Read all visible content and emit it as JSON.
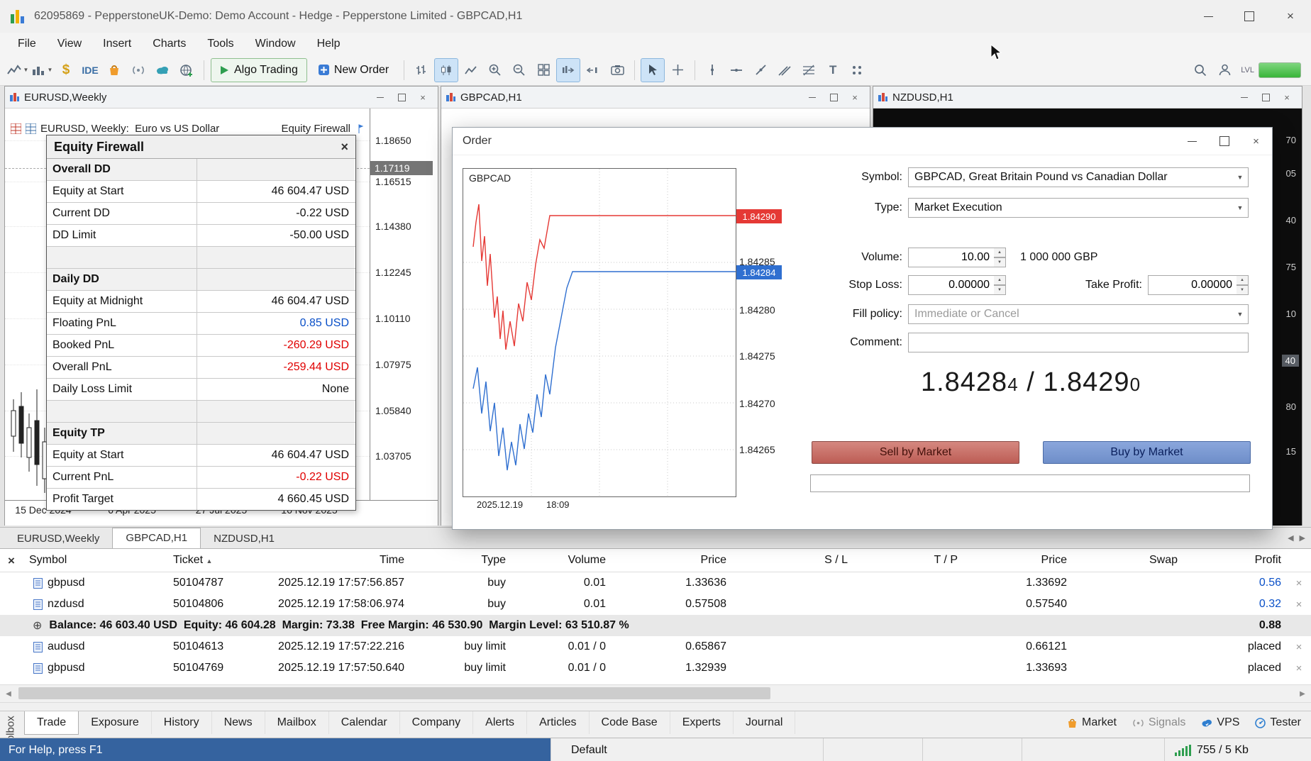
{
  "icons": {
    "close": "×",
    "sort_asc": "▲",
    "caret": "▼",
    "expand": "⊕",
    "arrow_left": "◀",
    "arrow_right": "▶",
    "spin_up": "▲",
    "spin_down": "▼"
  },
  "titlebar": {
    "title": "62095869 - PepperstoneUK-Demo: Demo Account - Hedge - Pepperstone Limited - GBPCAD,H1"
  },
  "menubar": {
    "items": [
      "File",
      "View",
      "Insert",
      "Charts",
      "Tools",
      "Window",
      "Help"
    ]
  },
  "toolbar": {
    "dollar": "$",
    "ide": "IDE",
    "algo_trading": "Algo Trading",
    "new_order": "New Order",
    "text_tool": "T",
    "lvl": "LVL"
  },
  "windows": {
    "eurusd": {
      "title": "EURUSD,Weekly",
      "legend": "EURUSD, Weekly:  Euro vs US Dollar",
      "legend_right": "Equity Firewall",
      "price_labels": [
        "1.18650",
        "1.17119",
        "1.16515",
        "1.14380",
        "1.12245",
        "1.10110",
        "1.07975",
        "1.05840",
        "1.03705"
      ],
      "date_labels": [
        "15 Dec 2024",
        "6 Apr 2025",
        "27 Jul 2025",
        "16 Nov 2025"
      ]
    },
    "gbpcad": {
      "title": "GBPCAD,H1"
    },
    "nzdusd": {
      "title": "NZDUSD,H1",
      "price_labels": [
        "70",
        "05",
        "40",
        "75",
        "10",
        "40",
        "80",
        "15"
      ]
    }
  },
  "equity_firewall": {
    "title": "Equity Firewall",
    "rows": [
      {
        "label": "Overall DD",
        "value": ""
      },
      {
        "label": "Equity at Start",
        "value": "46 604.47 USD"
      },
      {
        "label": "Current DD",
        "value": "-0.22 USD"
      },
      {
        "label": "DD Limit",
        "value": "-50.00 USD"
      },
      {
        "label": "",
        "value": ""
      },
      {
        "label": "Daily DD",
        "value": ""
      },
      {
        "label": "Equity at Midnight",
        "value": "46 604.47 USD"
      },
      {
        "label": "Floating PnL",
        "value": "0.85 USD"
      },
      {
        "label": "Booked PnL",
        "value": "-260.29 USD"
      },
      {
        "label": "Overall PnL",
        "value": "-259.44 USD"
      },
      {
        "label": "Daily Loss Limit",
        "value": "None"
      },
      {
        "label": "",
        "value": ""
      },
      {
        "label": "Equity TP",
        "value": ""
      },
      {
        "label": "Equity at Start",
        "value": "46 604.47 USD"
      },
      {
        "label": "Current PnL",
        "value": "-0.22 USD"
      },
      {
        "label": "Profit Target",
        "value": "4 660.45 USD"
      }
    ]
  },
  "order_dialog": {
    "title": "Order",
    "chart": {
      "symbol": "GBPCAD",
      "ask": "1.84290",
      "bid": "1.84284",
      "scale": [
        "1.84285",
        "1.84280",
        "1.84275",
        "1.84270",
        "1.84265"
      ],
      "date": "2025.12.19",
      "time": "18:09"
    },
    "fields": {
      "symbol_label": "Symbol:",
      "symbol_value": "GBPCAD, Great Britain Pound vs Canadian Dollar",
      "type_label": "Type:",
      "type_value": "Market Execution",
      "volume_label": "Volume:",
      "volume_value": "10.00",
      "volume_info": "1 000 000 GBP",
      "sl_label": "Stop Loss:",
      "sl_value": "0.00000",
      "tp_label": "Take Profit:",
      "tp_value": "0.00000",
      "fill_label": "Fill policy:",
      "fill_value": "Immediate or Cancel",
      "comment_label": "Comment:"
    },
    "quote": {
      "bid_big": "1.8428",
      "bid_small": "4",
      "sep": " / ",
      "ask_big": "1.8429",
      "ask_small": "0"
    },
    "sell": "Sell by Market",
    "buy": "Buy by Market"
  },
  "chart_tabs": [
    "EURUSD,Weekly",
    "GBPCAD,H1",
    "NZDUSD,H1"
  ],
  "trade_panel": {
    "columns": [
      "Symbol",
      "Ticket",
      "Time",
      "Type",
      "Volume",
      "Price",
      "S / L",
      "T / P",
      "Price",
      "Swap",
      "Profit"
    ],
    "positions": [
      {
        "symbol": "gbpusd",
        "ticket": "50104787",
        "time": "2025.12.19 17:57:56.857",
        "type": "buy",
        "volume": "0.01",
        "price": "1.33636",
        "sl": "",
        "tp": "",
        "price2": "1.33692",
        "swap": "",
        "profit": "0.56"
      },
      {
        "symbol": "nzdusd",
        "ticket": "50104806",
        "time": "2025.12.19 17:58:06.974",
        "type": "buy",
        "volume": "0.01",
        "price": "0.57508",
        "sl": "",
        "tp": "",
        "price2": "0.57540",
        "swap": "",
        "profit": "0.32"
      }
    ],
    "balance_row": {
      "text": "Balance: 46 603.40 USD  Equity: 46 604.28  Margin: 73.38  Free Margin: 46 530.90  Margin Level: 63 510.87 %",
      "profit": "0.88"
    },
    "orders": [
      {
        "symbol": "audusd",
        "ticket": "50104613",
        "time": "2025.12.19 17:57:22.216",
        "type": "buy limit",
        "volume": "0.01 / 0",
        "price": "0.65867",
        "sl": "",
        "tp": "",
        "price2": "0.66121",
        "swap": "",
        "profit": "placed"
      },
      {
        "symbol": "gbpusd",
        "ticket": "50104769",
        "time": "2025.12.19 17:57:50.640",
        "type": "buy limit",
        "volume": "0.01 / 0",
        "price": "1.32939",
        "sl": "",
        "tp": "",
        "price2": "1.33693",
        "swap": "",
        "profit": "placed"
      }
    ]
  },
  "toolbox": {
    "label": "Toolbox",
    "tabs": [
      "Trade",
      "Exposure",
      "History",
      "News",
      "Mailbox",
      "Calendar",
      "Company",
      "Alerts",
      "Articles",
      "Code Base",
      "Experts",
      "Journal"
    ],
    "market": "Market",
    "signals": "Signals",
    "vps": "VPS",
    "tester": "Tester"
  },
  "statusbar": {
    "help": "For Help, press F1",
    "profile": "Default",
    "traffic": "755 / 5 Kb"
  }
}
